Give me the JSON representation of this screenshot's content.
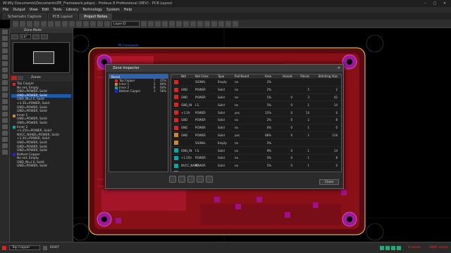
{
  "window": {
    "title": "W:\\My Documents\\Documents\\PE_Framework.pdsprj - Proteus 8 Professional (DEV) - PCB Layout"
  },
  "menu": [
    "File",
    "Output",
    "View",
    "Edit",
    "Tools",
    "Library",
    "Technology",
    "System",
    "Help"
  ],
  "tabs": [
    {
      "label": "Schematic Capture"
    },
    {
      "label": "PCB Layout"
    },
    {
      "label": "Project Notes"
    }
  ],
  "toolbar": {
    "layer_select": "Layer:D",
    "zoom": "0.0"
  },
  "left_panel": {
    "title": "Zone Mode",
    "angle": "0.0°",
    "zones_header": "Zones",
    "tree": [
      {
        "label": "Top Copper",
        "level": 0,
        "color": "#d22"
      },
      {
        "label": "No net, Empty",
        "level": 1
      },
      {
        "label": "GND=POWER, Solid",
        "level": 1
      },
      {
        "label": "GND=POWER, Solid",
        "level": 1,
        "selected": true
      },
      {
        "label": "GND_IN=I.S, Solid",
        "level": 1
      },
      {
        "label": "+3.3V=POWER, Solid",
        "level": 1
      },
      {
        "label": "GND=POWER, Solid",
        "level": 1
      },
      {
        "label": "GND=POWER, Solid",
        "level": 1
      },
      {
        "label": "Inner 1",
        "level": 0,
        "color": "#c83"
      },
      {
        "label": "GND=POWER, Solid",
        "level": 1
      },
      {
        "label": "GND=POWER, Solid",
        "level": 1
      },
      {
        "label": "Inner 2",
        "level": 0,
        "color": "#0aa"
      },
      {
        "label": "+1.25V=POWER, Solid",
        "level": 1
      },
      {
        "label": "NVCC_NAND=POWER, Solid",
        "level": 1
      },
      {
        "label": "+3.3V=POWER, Solid",
        "level": 1
      },
      {
        "label": "GND=POWER, Solid",
        "level": 1
      },
      {
        "label": "GND=POWER, Solid",
        "level": 1
      },
      {
        "label": "GND=POWER, Solid",
        "level": 1
      },
      {
        "label": "Bottom Copper",
        "level": 0,
        "color": "#22d"
      },
      {
        "label": "No net, Empty",
        "level": 1
      },
      {
        "label": "GND_IN=I.S, Solid",
        "level": 1
      },
      {
        "label": "GND=POWER, Solid",
        "level": 1
      }
    ]
  },
  "canvas": {
    "board_label": "PE Framework"
  },
  "dialog": {
    "title": "Zone Inspector",
    "close_label": "Close",
    "layers_header": "Board",
    "layers": [
      {
        "name": "Top Copper",
        "count": "7",
        "pct": "25%",
        "color": "#d22"
      },
      {
        "name": "Inner 1",
        "count": "2",
        "pct": "80%",
        "color": "#c83"
      },
      {
        "name": "Inner 2",
        "count": "6",
        "pct": "64%",
        "color": "#0aa"
      },
      {
        "name": "Bottom Copper",
        "count": "3",
        "pct": "56%",
        "color": "#22d"
      }
    ],
    "columns": [
      "",
      "Net",
      "Net Class",
      "Type",
      "Pull Board",
      "Area",
      "Islands",
      "Pieces",
      "Stitching Vias"
    ],
    "rows": [
      {
        "color": "#d22",
        "net": "",
        "class": "SIGNAL",
        "type": "Empty",
        "pull": "no",
        "area": "2%",
        "islands": "",
        "pieces": "",
        "vias": ""
      },
      {
        "color": "#d22",
        "net": "GND",
        "class": "POWER",
        "type": "Solid",
        "pull": "no",
        "area": "2%",
        "islands": "",
        "pieces": "5",
        "vias": "2"
      },
      {
        "color": "#d22",
        "net": "GND",
        "class": "POWER",
        "type": "Solid",
        "pull": "no",
        "area": "1%",
        "islands": "0",
        "pieces": "3",
        "vias": "42"
      },
      {
        "color": "#d22",
        "net": "GND_IN",
        "class": "I.S.",
        "type": "Solid",
        "pull": "no",
        "area": "5%",
        "islands": "0",
        "pieces": "1",
        "vias": "14"
      },
      {
        "color": "#d22",
        "net": "+3.3V",
        "class": "POWER",
        "type": "Solid",
        "pull": "yes",
        "area": "22%",
        "islands": "0",
        "pieces": "14",
        "vias": "0"
      },
      {
        "color": "#d22",
        "net": "GND",
        "class": "POWER",
        "type": "Solid",
        "pull": "no",
        "area": "2%",
        "islands": "0",
        "pieces": "2",
        "vias": "8"
      },
      {
        "color": "#d22",
        "net": "GND",
        "class": "POWER",
        "type": "Solid",
        "pull": "no",
        "area": "0%",
        "islands": "0",
        "pieces": "1",
        "vias": "0"
      },
      {
        "color": "#c83",
        "net": "GND",
        "class": "POWER",
        "type": "Solid",
        "pull": "yes",
        "area": "88%",
        "islands": "0",
        "pieces": "1",
        "vias": "218"
      },
      {
        "color": "#c83",
        "net": "",
        "class": "SIGNAL",
        "type": "Empty",
        "pull": "no",
        "area": "2%",
        "islands": "",
        "pieces": "",
        "vias": ""
      },
      {
        "color": "#0aa",
        "net": "GND_IN",
        "class": "I.S.",
        "type": "Solid",
        "pull": "no",
        "area": "9%",
        "islands": "0",
        "pieces": "1",
        "vias": "14"
      },
      {
        "color": "#0aa",
        "net": "+1.25V",
        "class": "POWER",
        "type": "Solid",
        "pull": "no",
        "area": "5%",
        "islands": "0",
        "pieces": "1",
        "vias": "8"
      },
      {
        "color": "#0aa",
        "net": "NVCC_NAND",
        "class": "POWER",
        "type": "Solid",
        "pull": "no",
        "area": "5%",
        "islands": "0",
        "pieces": "1",
        "vias": "0"
      },
      {
        "color": "#0aa",
        "net": "+3.3V",
        "class": "POWER",
        "type": "Solid",
        "pull": "yes",
        "area": "50%",
        "islands": "0",
        "pieces": "1",
        "vias": "14"
      },
      {
        "color": "#22d",
        "net": "",
        "class": "SIGNAL",
        "type": "Empty",
        "pull": "no",
        "area": "2%",
        "islands": "",
        "pieces": "",
        "vias": ""
      }
    ]
  },
  "status": {
    "layer": "Top Copper",
    "root": "ROOT",
    "messages": "0 errors",
    "clock": "2DRC errors"
  }
}
